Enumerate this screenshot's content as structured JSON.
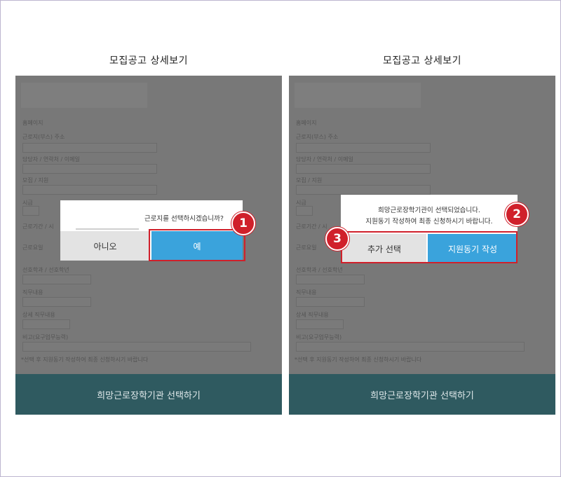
{
  "panels": [
    {
      "title": "모집공고 상세보기",
      "fields": [
        "홈페이지",
        "근로지(부스) 주소",
        "담당자 / 연락처 / 이메일",
        "모집 / 지원",
        "시급",
        "근로기간 / 시",
        "근로요일",
        "선호학과 / 선호학년",
        "직무내용",
        "상세 직무내용",
        "비고(요구업무능력)"
      ],
      "note": "*선택 후 지원동기 작성하여 최종 신청하시기 바랍니다",
      "bottom_button": "희망근로장학기관 선택하기",
      "dialog": {
        "message": "근로지를 선택하시겠습니까?",
        "buttons": [
          "아니오",
          "예"
        ]
      },
      "badge": "1"
    },
    {
      "title": "모집공고 상세보기",
      "fields": [
        "홈페이지",
        "근로지(부스) 주소",
        "담당자 / 연락처 / 이메일",
        "모집 / 지원",
        "시급",
        "근로기간 / 시",
        "근로요일",
        "선호학과 / 선호학년",
        "직무내용",
        "상세 직무내용",
        "비고(요구업무능력)"
      ],
      "note": "*선택 후 지원동기 작성하여 최종 신청하시기 바랍니다",
      "bottom_button": "희망근로장학기관 선택하기",
      "dialog": {
        "message_line1": "희망근로장학기관이 선택되었습니다.",
        "message_line2": "지원동기 작성하여 최종 신청하시기 바랍니다.",
        "buttons": [
          "추가 선택",
          "지원동기 작성"
        ]
      },
      "badges": [
        "2",
        "3"
      ]
    }
  ],
  "colors": {
    "accent_blue": "#3aa3dc",
    "highlight_red": "#d0202b",
    "bottom_bar": "#2f5a60"
  }
}
